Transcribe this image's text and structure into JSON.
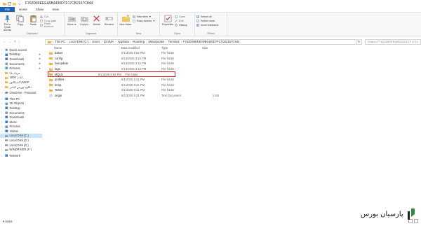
{
  "window": {
    "title": "F762D69EEEA9B4430D7F17CB2167C844"
  },
  "tabs": [
    "File",
    "Home",
    "Share",
    "View"
  ],
  "ribbon": {
    "clipboard": {
      "label": "Clipboard",
      "pin_label": "Pin to Quick access",
      "copy_label": "Copy",
      "paste_label": "Paste",
      "cut_label": "Cut",
      "copy_path_label": "Copy path",
      "paste_shortcut_label": "Paste shortcut"
    },
    "organize": {
      "label": "Organize",
      "move_to_label": "Move to",
      "copy_to_label": "Copy to",
      "delete_label": "Delete",
      "rename_label": "Rename"
    },
    "new": {
      "label": "New",
      "new_folder_label": "New folder",
      "new_item_label": "New item",
      "easy_access_label": "Easy access"
    },
    "open": {
      "label": "Open",
      "properties_label": "Properties",
      "open_label": "Open",
      "edit_label": "Edit",
      "history_label": "History"
    },
    "select": {
      "label": "Select",
      "select_all_label": "Select all",
      "select_none_label": "Select none",
      "invert_selection_label": "Invert selection"
    }
  },
  "address": {
    "segments": [
      "This PC",
      "Local Disk (C:)",
      "Users",
      "Dr.SMA",
      "AppData",
      "Roaming",
      "MetaQuotes",
      "Terminal",
      "F762D69EEEA9B4430D7F17CB2167C844"
    ],
    "search_placeholder": "Search F762D69EEEA9B4430D7F17CB2167C844"
  },
  "nav": {
    "items": [
      {
        "label": "Quick access",
        "icon": "star-icon"
      },
      {
        "label": "Desktop",
        "icon": "desktop-icon",
        "pinned": true
      },
      {
        "label": "Downloads",
        "icon": "download-icon",
        "pinned": true
      },
      {
        "label": "Documents",
        "icon": "document-icon",
        "pinned": true
      },
      {
        "label": "Pictures",
        "icon": "picture-icon",
        "pinned": true
      },
      {
        "label": "مرداد ۹۸",
        "icon": "folder-icon"
      },
      {
        "label": "کتاب 1000",
        "icon": "folder-icon"
      },
      {
        "label": "اندیکاتور VWAP",
        "icon": "folder-icon"
      },
      {
        "label": "دانلود بورس کتابی",
        "icon": "folder-icon"
      },
      {
        "label": "",
        "icon": "gap"
      },
      {
        "label": "OneDrive - Personal",
        "icon": "cloud-icon"
      },
      {
        "label": "",
        "icon": "gap"
      },
      {
        "label": "This PC",
        "icon": "pc-icon"
      },
      {
        "label": "3D Objects",
        "icon": "cube-icon"
      },
      {
        "label": "Desktop",
        "icon": "desktop-icon"
      },
      {
        "label": "Documents",
        "icon": "document-icon"
      },
      {
        "label": "Downloads",
        "icon": "download-icon"
      },
      {
        "label": "Music",
        "icon": "music-icon"
      },
      {
        "label": "Pictures",
        "icon": "picture-icon"
      },
      {
        "label": "Videos",
        "icon": "video-icon"
      },
      {
        "label": "Local Disk (C:)",
        "icon": "drive-icon",
        "selected": true
      },
      {
        "label": "Local Disk (D:)",
        "icon": "drive-icon"
      },
      {
        "label": "Local Disk (E:)",
        "icon": "drive-icon"
      },
      {
        "label": "WINDRIVER (F:)",
        "icon": "drive-icon"
      },
      {
        "label": "",
        "icon": "gap"
      },
      {
        "label": "Network",
        "icon": "network-icon"
      }
    ]
  },
  "columns": {
    "name": "Name",
    "date": "Date modified",
    "type": "Type",
    "size": "Size"
  },
  "files": [
    {
      "name": "bases",
      "date": "6/1/2025 9:54 PM",
      "type": "File folder",
      "size": "",
      "icon": "folder-icon"
    },
    {
      "name": "config",
      "date": "6/14/2025 3:15 PM",
      "type": "File folder",
      "size": "",
      "icon": "folder-icon"
    },
    {
      "name": "liveupdate",
      "date": "6/14/2025 3:15 PM",
      "type": "File folder",
      "size": "",
      "icon": "folder-icon"
    },
    {
      "name": "logs",
      "date": "6/14/2025 3:15 PM",
      "type": "File folder",
      "size": "",
      "icon": "folder-icon"
    },
    {
      "name": "MQL5",
      "date": "6/1/2025 9:54 PM",
      "type": "File folder",
      "size": "",
      "icon": "folder-icon",
      "highlighted": true
    },
    {
      "name": "profiles",
      "date": "6/1/2025 9:21 PM",
      "type": "File folder",
      "size": "",
      "icon": "folder-icon"
    },
    {
      "name": "temp",
      "date": "6/1/2025 9:21 PM",
      "type": "File folder",
      "size": "",
      "icon": "folder-icon"
    },
    {
      "name": "Tester",
      "date": "6/1/2025 9:21 PM",
      "type": "File folder",
      "size": "",
      "icon": "folder-icon"
    },
    {
      "name": "origin",
      "date": "6/1/2025 9:21 PM",
      "type": "Text Document",
      "size": "1 KB",
      "icon": "text-file-icon"
    }
  ],
  "status": {
    "item_count": "9 items"
  },
  "watermark": {
    "text": "پارسیان بورس"
  },
  "colors": {
    "accent": "#1a62b8",
    "folder": "#e8b84a",
    "selection": "#cce4f7",
    "highlight_box": "#d62828",
    "logo_green": "#2e8b3c"
  }
}
